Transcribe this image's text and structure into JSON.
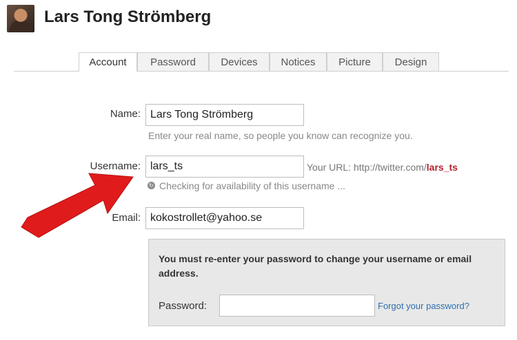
{
  "profile": {
    "name": "Lars Tong Strömberg"
  },
  "tabs": [
    {
      "label": "Account"
    },
    {
      "label": "Password"
    },
    {
      "label": "Devices"
    },
    {
      "label": "Notices"
    },
    {
      "label": "Picture"
    },
    {
      "label": "Design"
    }
  ],
  "form": {
    "name": {
      "label": "Name:",
      "value": "Lars Tong Strömberg",
      "hint": "Enter your real name, so people you know can recognize you."
    },
    "username": {
      "label": "Username:",
      "value": "lars_ts",
      "url_prefix": "Your URL: http://twitter.com/",
      "url_username": "lars_ts",
      "status": "Checking for availability of this username ..."
    },
    "email": {
      "label": "Email:",
      "value": "kokostrollet@yahoo.se"
    }
  },
  "confirm": {
    "message": "You must re-enter your password to change your username or email address.",
    "password_label": "Password:",
    "password_value": "",
    "forgot_link": "Forgot your password?"
  },
  "colors": {
    "annotation_arrow": "#e01b1b",
    "link": "#2f6fb1",
    "url_username": "#b2222c"
  },
  "icons": {
    "annotation": "red-arrow-icon",
    "status": "spinner-icon"
  }
}
